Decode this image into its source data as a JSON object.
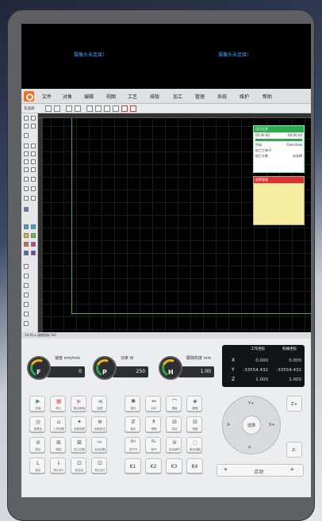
{
  "camera": {
    "msg_left": "摄像头未连接!",
    "msg_right": "摄像头未连接!"
  },
  "menu": {
    "items": [
      "文件",
      "对象",
      "编辑",
      "视图",
      "工艺",
      "排版",
      "加工",
      "管理",
      "系统",
      "维护",
      "帮助"
    ]
  },
  "toolbar": {
    "select_label": "先选择"
  },
  "status": {
    "text": "10.91  ▸  请按鼠标 %0"
  },
  "panel1": {
    "title": "运行信息",
    "r1a": "00:00:00",
    "r1b": "00:00:00",
    "r2a": "空闲",
    "r2b": "Overdraw",
    "r3": "加工工单 0",
    "r4a": "加工计数",
    "r4b": "未选择"
  },
  "panel2": {
    "title": "报警管理"
  },
  "gauges": [
    {
      "letter": "F",
      "label": "速度 mm/min",
      "value": "0"
    },
    {
      "letter": "P",
      "label": "功率 W",
      "value": "250"
    },
    {
      "letter": "H",
      "label": "跟随高度 mm",
      "value": "1.00"
    }
  ],
  "coords": {
    "h1": "工作坐标",
    "h2": "机械坐标",
    "rows": [
      {
        "ax": "X",
        "work": "0.000",
        "mach": "0.000"
      },
      {
        "ax": "Y",
        "work": "-33554.432",
        "mach": "-33554.432"
      },
      {
        "ax": "Z",
        "work": "1.000",
        "mach": "1.000"
      }
    ]
  },
  "buttons": {
    "row1": [
      {
        "ic": "▶",
        "tx": "开始"
      },
      {
        "ic": "■",
        "tx": "停止"
      },
      {
        "ic": "▶",
        "tx": "断点继续"
      },
      {
        "ic": "◀",
        "tx": "回退"
      }
    ],
    "row2": [
      {
        "ic": "◎",
        "tx": "回零点"
      },
      {
        "ic": "⌂",
        "tx": "工作回零"
      },
      {
        "ic": "✦",
        "tx": "全部回零"
      },
      {
        "ic": "⊕",
        "tx": "回标定位"
      }
    ],
    "row3": [
      {
        "ic": "⊘",
        "tx": "急拉"
      },
      {
        "ic": "⊞",
        "tx": "顺延"
      },
      {
        "ic": "⊠",
        "tx": "加工边框"
      },
      {
        "ic": "✂",
        "tx": "点动切割"
      }
    ],
    "row4": [
      {
        "ic": "L",
        "tx": "标定"
      },
      {
        "ic": "↓",
        "tx": "标记点1"
      },
      {
        "ic": "⊡",
        "tx": "标记点"
      },
      {
        "ic": "⊡",
        "tx": "标记点2"
      }
    ],
    "mid1": [
      {
        "ic": "✱",
        "tx": "激光"
      },
      {
        "ic": "⇔",
        "tx": "对中"
      },
      {
        "ic": "⌒",
        "tx": "调高"
      },
      {
        "ic": "◈",
        "tx": "跟随"
      }
    ],
    "mid2": [
      {
        "ic": "⇵",
        "tx": "抬头"
      },
      {
        "ic": "↟",
        "tx": "喷嘴"
      },
      {
        "ic": "⊟",
        "tx": "寻边"
      },
      {
        "ic": "⊟",
        "tx": "测量"
      }
    ],
    "mid3": [
      {
        "ic": "Air",
        "tx": "空气气"
      },
      {
        "ic": "N₂",
        "tx": "氮气"
      },
      {
        "ic": "⊜",
        "tx": "自动调节"
      },
      {
        "ic": "◌",
        "tx": "激光测距"
      }
    ],
    "k": [
      "K1",
      "K2",
      "K3",
      "K4"
    ]
  },
  "jog": {
    "center": "选择",
    "up": "Y+",
    "down": "Y-",
    "left": "X-",
    "right": "X+",
    "zplus": "Z+",
    "zminus": "Z-",
    "mode": "点动",
    "prev": "«",
    "next": "»"
  }
}
